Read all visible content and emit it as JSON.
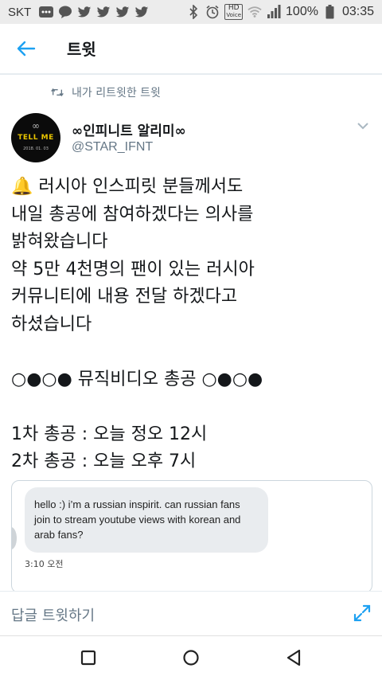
{
  "status_bar": {
    "carrier": "SKT",
    "battery": "100%",
    "time": "03:35",
    "hd_top": "HD",
    "hd_bottom": "Voice"
  },
  "app_bar": {
    "title": "트윗"
  },
  "retweet_header": {
    "label": "내가 리트윗한 트윗"
  },
  "author": {
    "name": "∞인피니트 알리미∞",
    "handle": "@STAR_IFNT",
    "avatar_text": {
      "infinity": "∞",
      "album": "TELL ME",
      "date": "2018. 01. 03"
    }
  },
  "tweet": {
    "text": "🔔 러시아 인스피릿 분들께서도\n내일 총공에 참여하겠다는 의사를\n밝혀왔습니다\n약 5만 4천명의 팬이 있는 러시아\n커뮤니티에 내용 전달 하겠다고\n하셨습니다\n\n○●○● 뮤직비디오 총공 ○●○●\n\n1차 총공 : 오늘 정오 12시\n2차 총공 : 오늘 오후 7시"
  },
  "embedded_image": {
    "message": "hello :) i’m a russian inspirit. can russian fans join to stream youtube views with korean and arab fans?",
    "time": "3:10 오전"
  },
  "reply_bar": {
    "placeholder": "답글 트윗하기"
  },
  "colors": {
    "accent": "#1da1f2",
    "secondary_text": "#657786",
    "primary_text": "#14171a",
    "divider": "#e6ecf0"
  }
}
